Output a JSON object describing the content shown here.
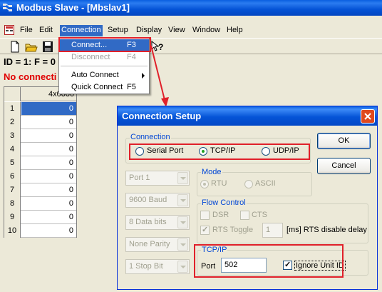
{
  "window": {
    "title": "Modbus Slave - [Mbslav1]"
  },
  "menubar": {
    "items": [
      "File",
      "Edit",
      "Connection",
      "Setup",
      "Display",
      "View",
      "Window",
      "Help"
    ]
  },
  "status": {
    "id_line": "ID = 1: F = 0",
    "error_line": "No connecti"
  },
  "connection_menu": {
    "items": [
      {
        "label": "Connect...",
        "shortcut": "F3"
      },
      {
        "label": "Disconnect",
        "shortcut": "F4"
      },
      {
        "label": "Auto Connect",
        "shortcut": ""
      },
      {
        "label": "Quick Connect",
        "shortcut": "F5"
      }
    ]
  },
  "grid": {
    "column_header": "4x0000",
    "rows": [
      {
        "num": "1",
        "value": "0"
      },
      {
        "num": "2",
        "value": "0"
      },
      {
        "num": "3",
        "value": "0"
      },
      {
        "num": "4",
        "value": "0"
      },
      {
        "num": "5",
        "value": "0"
      },
      {
        "num": "6",
        "value": "0"
      },
      {
        "num": "7",
        "value": "0"
      },
      {
        "num": "8",
        "value": "0"
      },
      {
        "num": "9",
        "value": "0"
      },
      {
        "num": "10",
        "value": "0"
      }
    ]
  },
  "dialog": {
    "title": "Connection Setup",
    "connection_group": {
      "label": "Connection",
      "options": [
        "Serial Port",
        "TCP/IP",
        "UDP/IP"
      ],
      "selected": "TCP/IP"
    },
    "port_combo": "Port 1",
    "baud_combo": "9600 Baud",
    "databits_combo": "8 Data bits",
    "parity_combo": "None Parity",
    "stopbit_combo": "1 Stop Bit",
    "mode_group": {
      "label": "Mode",
      "options": [
        "RTU",
        "ASCII"
      ]
    },
    "flow_group": {
      "label": "Flow Control",
      "dsr": "DSR",
      "cts": "CTS",
      "rts_toggle": "RTS Toggle",
      "rts_delay_value": "1",
      "rts_delay_label": "[ms] RTS disable delay"
    },
    "tcpip_group": {
      "label": "TCP/IP",
      "port_label": "Port",
      "port_value": "502",
      "ignore_unit_id": "Ignore Unit ID"
    },
    "ok_label": "OK",
    "cancel_label": "Cancel"
  },
  "colors": {
    "annotation": "#e0202a",
    "xp_blue": "#0554d7",
    "selection": "#316ac5"
  }
}
